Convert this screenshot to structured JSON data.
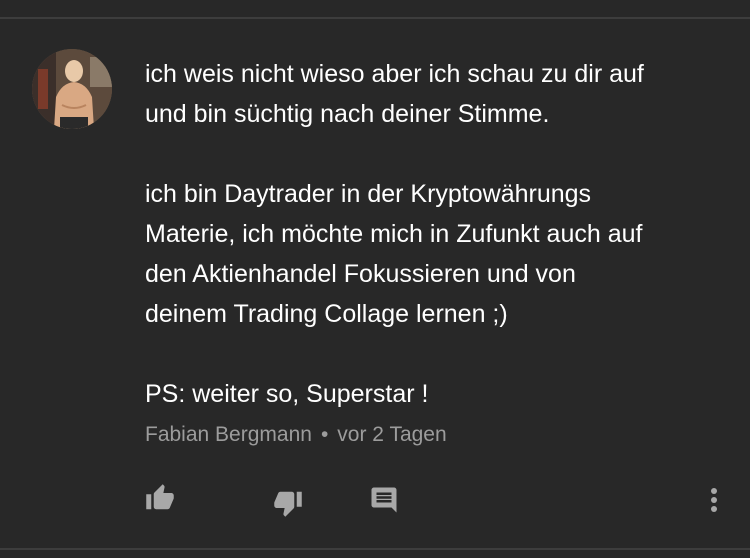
{
  "comment": {
    "paragraphs": [
      "ich weis nicht wieso aber ich schau zu dir auf\nund bin süchtig nach deiner Stimme.",
      "ich bin Daytrader in der Kryptowährungs\nMaterie, ich möchte mich in Zufunkt auch auf\nden Aktienhandel Fokussieren und von\ndeinem Trading Collage lernen ;)",
      "PS: weiter so, Superstar !"
    ],
    "author": "Fabian Bergmann",
    "separator": "•",
    "timestamp": "vor 2 Tagen"
  },
  "actions": {
    "like_icon": "thumb-up-icon",
    "dislike_icon": "thumb-down-icon",
    "reply_icon": "reply-comment-icon",
    "more_icon": "more-vert-icon"
  },
  "colors": {
    "background": "#282828",
    "text": "#ffffff",
    "meta": "#9c9c9c",
    "icon": "#a8a8a8"
  }
}
